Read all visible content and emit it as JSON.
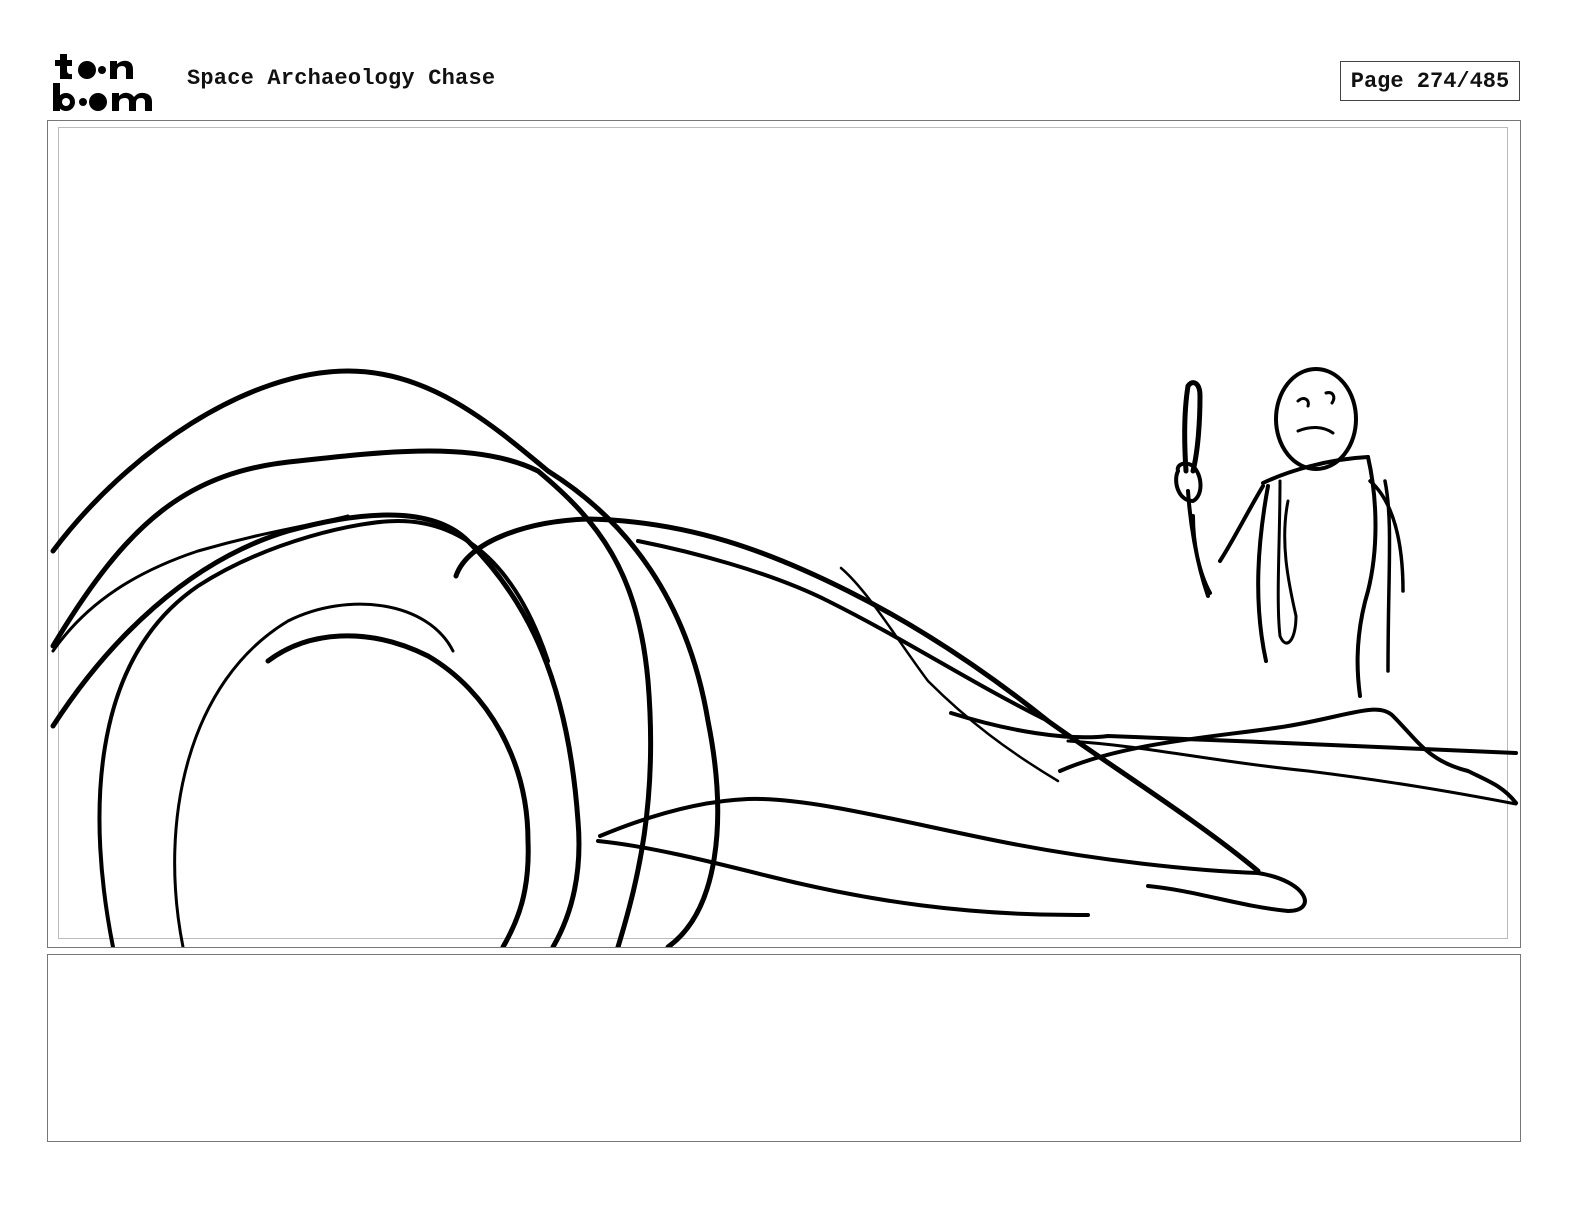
{
  "header": {
    "logo": {
      "line1": "toon",
      "line2": "boom"
    },
    "title": "Space Archaeology Chase",
    "page_label": "Page 274/485"
  },
  "panel": {
    "image": "storyboard-sketch",
    "notes": ""
  },
  "colors": {
    "ink": "#000000",
    "frame": "#777777",
    "background": "#ffffff"
  }
}
